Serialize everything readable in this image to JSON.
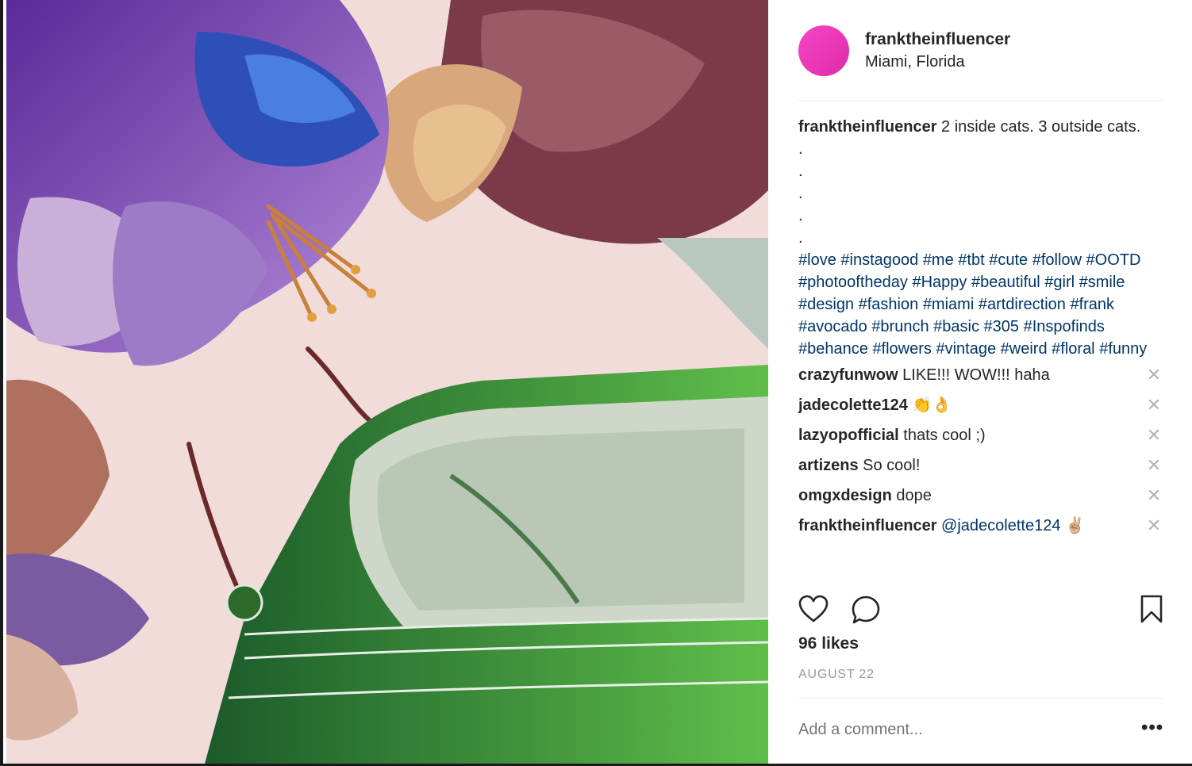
{
  "post": {
    "username": "franktheinfluencer",
    "location": "Miami, Florida",
    "caption_text": "2 inside cats. 3 outside cats.",
    "dots": [
      ".",
      ".",
      ".",
      ".",
      "."
    ],
    "hashtags": [
      "#love",
      "#instagood",
      "#me",
      "#tbt",
      "#cute",
      "#follow",
      "#OOTD",
      "#photooftheday",
      "#Happy",
      "#beautiful",
      "#girl",
      "#smile",
      "#design",
      "#fashion",
      "#miami",
      "#artdirection",
      "#frank",
      "#avocado",
      "#brunch",
      "#basic",
      "#305",
      "#Inspofinds",
      "#behance",
      "#flowers",
      "#vintage",
      "#weird",
      "#floral",
      "#funny"
    ],
    "comments": [
      {
        "user": "crazyfunwow",
        "text": "LIKE!!! WOW!!! haha",
        "mention": ""
      },
      {
        "user": "jadecolette124",
        "text": "👏👌",
        "mention": ""
      },
      {
        "user": "lazyopofficial",
        "text": "thats cool ;)",
        "mention": ""
      },
      {
        "user": "artizens",
        "text": "So cool!",
        "mention": ""
      },
      {
        "user": "omgxdesign",
        "text": "dope",
        "mention": ""
      },
      {
        "user": "franktheinfluencer",
        "text": "✌🏼",
        "mention": "@jadecolette124"
      }
    ],
    "remove_glyph": "✕",
    "likes": "96 likes",
    "date": "AUGUST 22",
    "comment_placeholder": "Add a comment...",
    "more_glyph": "•••",
    "icons": [
      "heart-icon",
      "comment-bubble-icon",
      "bookmark-icon"
    ],
    "colors": {
      "avatar": "#e53fbd",
      "hashtag": "#003569",
      "muted": "#999999"
    }
  }
}
